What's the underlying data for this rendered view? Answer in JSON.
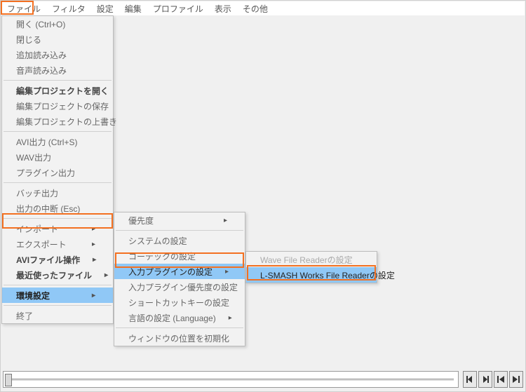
{
  "menubar": {
    "items": [
      "ファイル",
      "フィルタ",
      "設定",
      "編集",
      "プロファイル",
      "表示",
      "その他"
    ]
  },
  "menu1": {
    "items": [
      {
        "label": "開く (Ctrl+O)"
      },
      {
        "label": "閉じる"
      },
      {
        "label": "追加読み込み"
      },
      {
        "label": "音声読み込み"
      },
      {
        "sep": true
      },
      {
        "label": "編集プロジェクトを開く",
        "bold": true
      },
      {
        "label": "編集プロジェクトの保存"
      },
      {
        "label": "編集プロジェクトの上書き"
      },
      {
        "sep": true
      },
      {
        "label": "AVI出力 (Ctrl+S)"
      },
      {
        "label": "WAV出力"
      },
      {
        "label": "プラグイン出力"
      },
      {
        "sep": true
      },
      {
        "label": "バッチ出力"
      },
      {
        "label": "出力の中断 (Esc)"
      },
      {
        "sep": true
      },
      {
        "label": "インポート",
        "arrow": true
      },
      {
        "label": "エクスポート",
        "arrow": true
      },
      {
        "label": "AVIファイル操作",
        "bold": true,
        "arrow": true
      },
      {
        "label": "最近使ったファイル",
        "bold": true,
        "arrow": true
      },
      {
        "sep": true
      },
      {
        "label": "環境設定",
        "bold": true,
        "arrow": true,
        "selected": true
      },
      {
        "sep": true
      },
      {
        "label": "終了"
      }
    ]
  },
  "menu2": {
    "items": [
      {
        "label": "優先度",
        "arrow": true
      },
      {
        "sep": true
      },
      {
        "label": "システムの設定"
      },
      {
        "label": "コーデックの設定"
      },
      {
        "label": "入力プラグインの設定",
        "arrow": true,
        "selected": true
      },
      {
        "label": "入力プラグイン優先度の設定"
      },
      {
        "label": "ショートカットキーの設定"
      },
      {
        "label": "言語の設定 (Language)",
        "arrow": true
      },
      {
        "sep": true
      },
      {
        "label": "ウィンドウの位置を初期化"
      }
    ]
  },
  "menu3": {
    "items": [
      {
        "label": "Wave File Readerの設定",
        "disabled": true
      },
      {
        "label": "L-SMASH Works File Readerの設定",
        "selected": true
      }
    ]
  },
  "nav": {
    "first": "❘◀",
    "prev": "▶❘",
    "step_back": "❘◀",
    "step_fwd": "▶❘"
  }
}
